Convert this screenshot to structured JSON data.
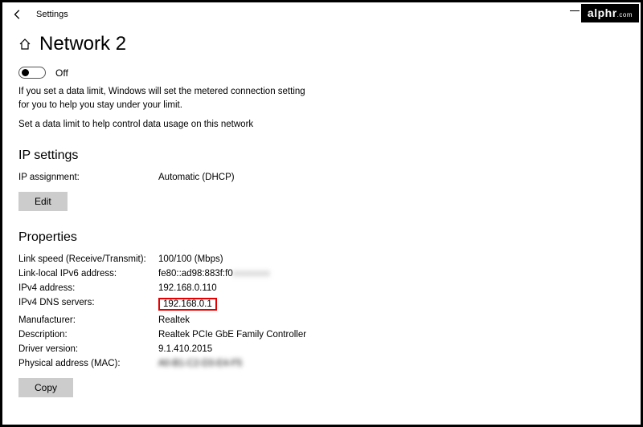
{
  "watermark": {
    "brand": "alphr",
    "suffix": ".com"
  },
  "header": {
    "app": "Settings",
    "title": "Network 2"
  },
  "metered": {
    "toggle_label": "Off",
    "description_line1": "If you set a data limit, Windows will set the metered connection setting",
    "description_line2": "for you to help you stay under your limit.",
    "link": "Set a data limit to help control data usage on this network"
  },
  "ip_settings": {
    "heading": "IP settings",
    "assignment_label": "IP assignment:",
    "assignment_value": "Automatic (DHCP)",
    "edit_label": "Edit"
  },
  "properties": {
    "heading": "Properties",
    "rows": [
      {
        "label": "Link speed (Receive/Transmit):",
        "value": "100/100 (Mbps)"
      },
      {
        "label": "Link-local IPv6 address:",
        "value": "fe80::ad98:883f:f0"
      },
      {
        "label": "IPv4 address:",
        "value": "192.168.0.110"
      },
      {
        "label": "IPv4 DNS servers:",
        "value": "192.168.0.1"
      },
      {
        "label": "Manufacturer:",
        "value": "Realtek"
      },
      {
        "label": "Description:",
        "value": "Realtek PCIe GbE Family Controller"
      },
      {
        "label": "Driver version:",
        "value": "9.1.410.2015"
      },
      {
        "label": "Physical address (MAC):",
        "value": "A0-B1-C2-D3-E4-F5"
      }
    ],
    "copy_label": "Copy"
  }
}
